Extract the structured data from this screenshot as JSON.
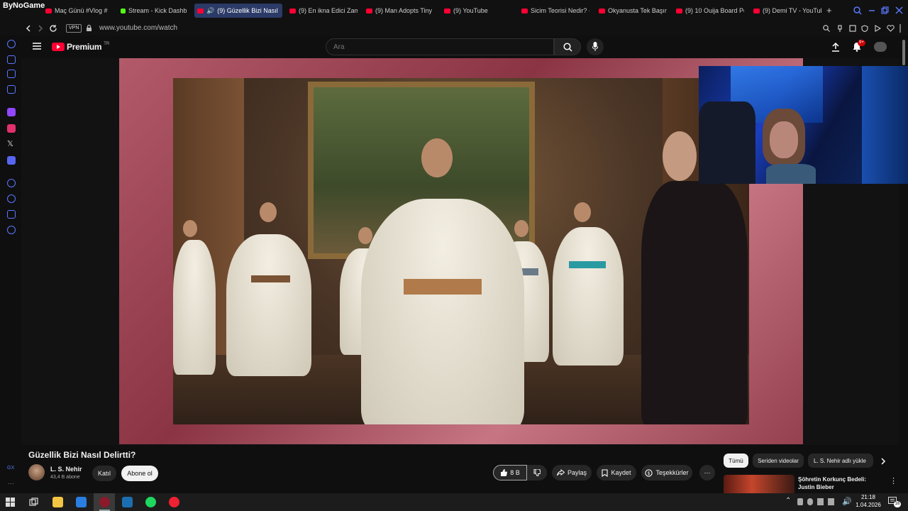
{
  "browser": {
    "logo": "ByNoGame",
    "tabs": [
      {
        "label": "Maç Günü #Vlog #",
        "icon": "youtube-icon"
      },
      {
        "label": "Stream - Kick Dashb",
        "icon": "kick-icon"
      },
      {
        "label": "(9) Güzellik Bizi Nasıl",
        "icon": "youtube-icon",
        "active": true
      },
      {
        "label": "(9) En ikna Edici Zam",
        "icon": "youtube-icon"
      },
      {
        "label": "(9) Man Adopts Tiny",
        "icon": "youtube-icon"
      },
      {
        "label": "(9) YouTube",
        "icon": "youtube-icon"
      },
      {
        "label": "Sicim Teorisi Nedir? -",
        "icon": "youtube-icon"
      },
      {
        "label": "Okyanusta Tek Başın",
        "icon": "youtube-icon"
      },
      {
        "label": "(9) 10 Ouija Board Po",
        "icon": "youtube-icon"
      },
      {
        "label": "(9) Demi TV - YouTub",
        "icon": "youtube-icon"
      }
    ],
    "new_tab": "+",
    "vpn_label": "VPN",
    "url": "www.youtube.com/watch"
  },
  "youtube": {
    "logo_text": "Premium",
    "logo_region": "TR",
    "search_placeholder": "Ara",
    "notification_count": "9+"
  },
  "video": {
    "title": "Güzellik Bizi Nasıl Delirtti?",
    "channel_name": "L. S. Nehir",
    "subscribers": "43,4 B abone",
    "join_label": "Katıl",
    "subscribe_label": "Abone ol",
    "like_count": "8 B",
    "share_label": "Paylaş",
    "save_label": "Kaydet",
    "thanks_label": "Teşekkürler",
    "more_label": "⋯"
  },
  "recommendations": {
    "chips": [
      "Tümü",
      "Seriden videolar",
      "L. S. Nehir adlı yükle"
    ],
    "first_title": "Şöhretin Korkunç Bedeli: Justin Bieber"
  },
  "taskbar": {
    "time": "21:18",
    "date": "1.04.2026",
    "notifications": "16"
  },
  "colors": {
    "youtube_red": "#ff0033",
    "accent_blue": "#5a78ff",
    "frame_pink": "#a24a5a"
  }
}
